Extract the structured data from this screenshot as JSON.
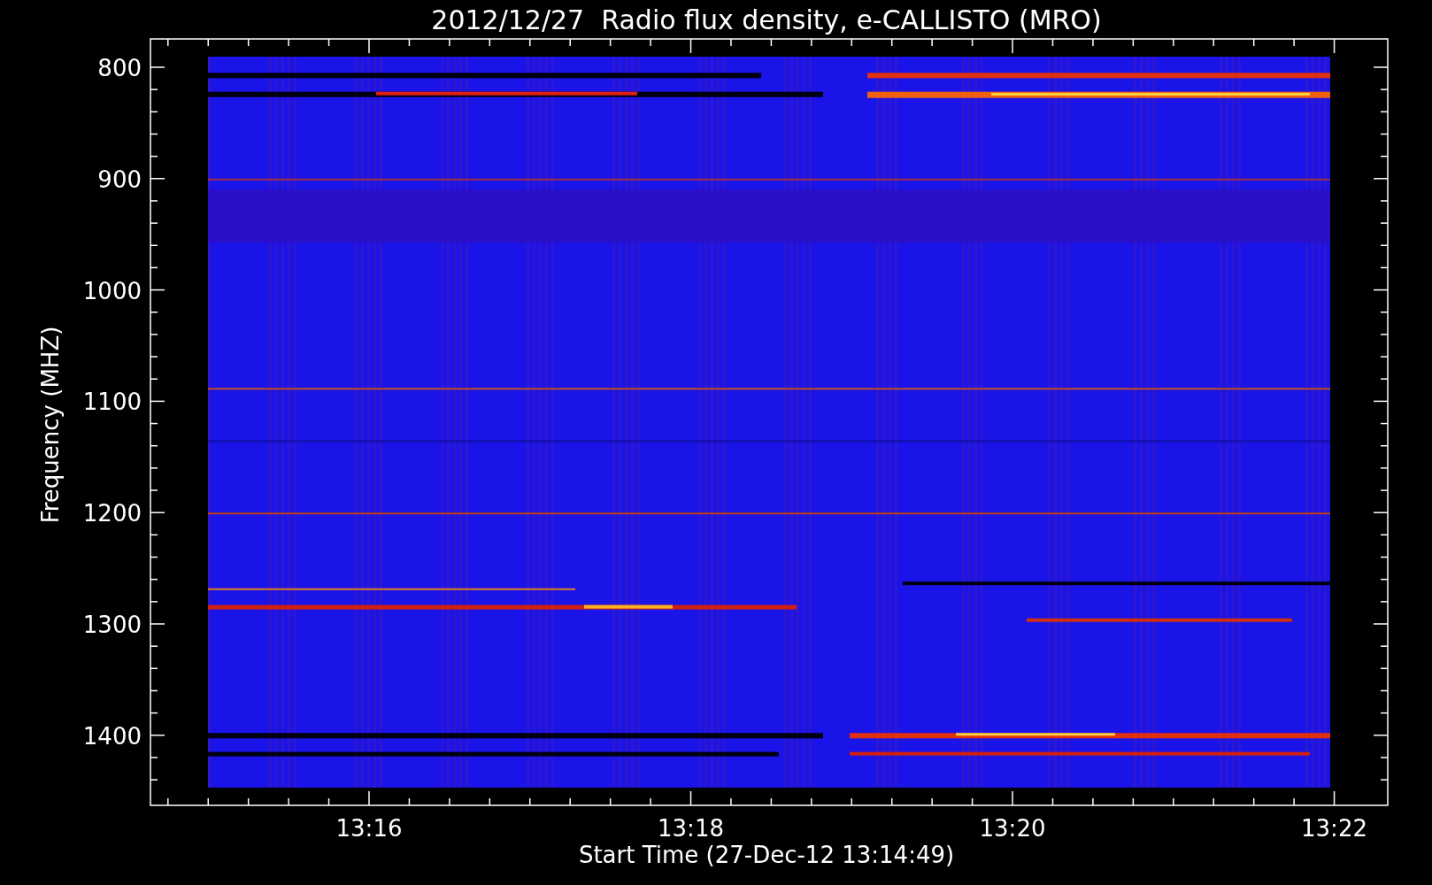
{
  "title": "2012/12/27  Radio flux density, e-CALLISTO (MRO)",
  "y_axis": {
    "label": "Frequency (MHZ)",
    "ticks": [
      "800",
      "900",
      "1000",
      "1100",
      "1200",
      "1300",
      "1400"
    ]
  },
  "x_axis": {
    "label": "Start Time (27-Dec-12 13:14:49)",
    "ticks": [
      "13:16",
      "13:18",
      "13:20",
      "13:22"
    ]
  }
}
